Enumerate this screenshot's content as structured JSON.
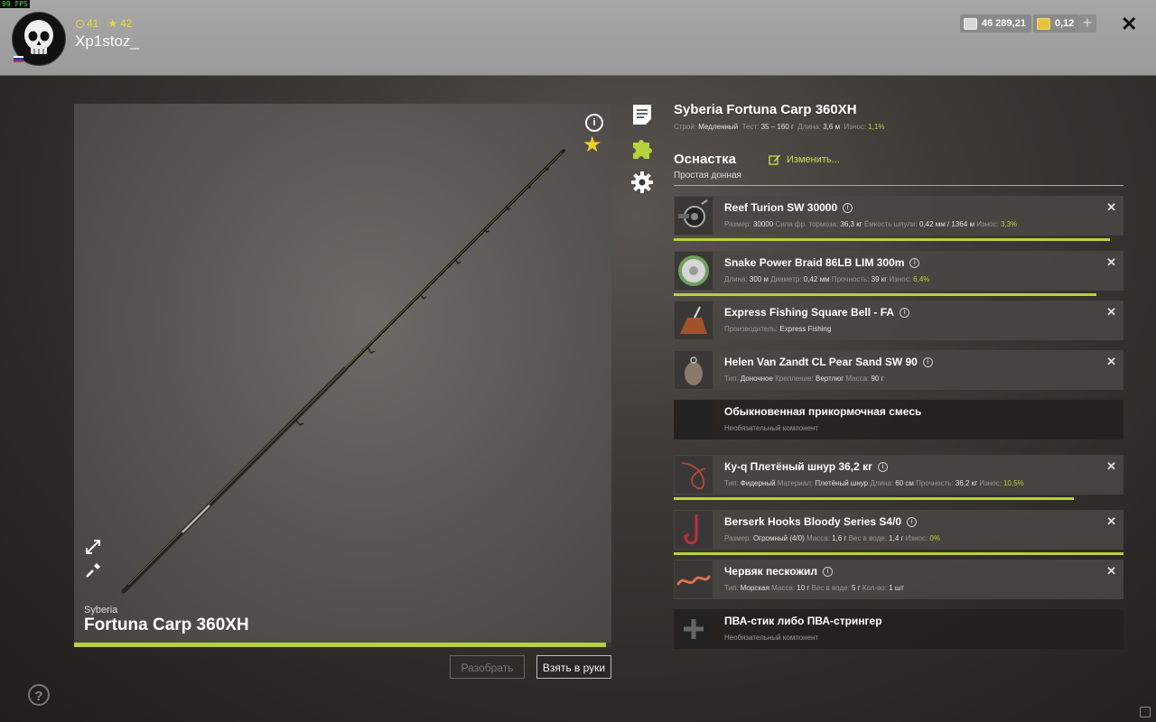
{
  "fps": "99 FPS",
  "player": {
    "name": "Xp1stoz_",
    "level_a": "41",
    "level_b": "42",
    "flag_colors": [
      "#ffffff",
      "#1f3fb8",
      "#d22f2f"
    ]
  },
  "currency": {
    "silver": "46 289,21",
    "gold": "0,12",
    "add": "+"
  },
  "close": "✕",
  "rod": {
    "brand": "Syberia",
    "model": "Fortuna Carp 360XH",
    "full_name": "Syberia Fortuna Carp 360XH",
    "specs": {
      "build_label": "Строй:",
      "build": "Медленный",
      "test_label": "Тест:",
      "test": "35 – 160 г",
      "length_label": "Длина:",
      "length": "3,6 м",
      "wear_label": "Износ:",
      "wear": "1,1%"
    },
    "wear_fraction": 0.99
  },
  "buttons": {
    "disassemble": "Разобрать",
    "take": "Взять в руки"
  },
  "rig": {
    "title": "Оснастка",
    "type": "Простая донная",
    "edit": "Изменить..."
  },
  "accent_color": "#b5d33a",
  "items": [
    {
      "name": "Reef Turion SW 30000",
      "desc": [
        [
          "Размер:",
          "30000"
        ],
        [
          "Сила фр. тормоза:",
          "36,3 кг"
        ],
        [
          "Ёмкость шпули:",
          "0,42 мм / 1364 м"
        ],
        [
          "Износ:",
          "3,3%"
        ]
      ],
      "bar": 0.97,
      "icon": "reel-icon"
    },
    {
      "name": "Snake Power Braid 86LB LIM 300m",
      "desc": [
        [
          "Длина:",
          "300 м"
        ],
        [
          "Диаметр:",
          "0,42 мм"
        ],
        [
          "Прочность:",
          "39 кг"
        ],
        [
          "Износ:",
          "6,4%"
        ]
      ],
      "bar": 0.94,
      "icon": "line-spool-icon"
    },
    {
      "name": "Express Fishing Square Bell - FA",
      "desc": [
        [
          "Производитель:",
          "Express Fishing"
        ]
      ],
      "bar": 0,
      "icon": "feeder-icon"
    },
    {
      "name": "Helen Van Zandt CL Pear Sand SW 90",
      "desc": [
        [
          "Тип:",
          "Доночное"
        ],
        [
          "Крепление:",
          "Вертлюг"
        ],
        [
          "Масса:",
          "90 г"
        ]
      ],
      "bar": 0,
      "icon": "sinker-icon"
    },
    {
      "name": "Обыкновенная прикормочная смесь",
      "desc_plain": "Необязательный компонент",
      "bar": 0,
      "icon": "empty-slot"
    },
    {
      "name": "Ку-q Плетёный шнур 36,2 кг",
      "desc": [
        [
          "Тип:",
          "Фидерный"
        ],
        [
          "Материал:",
          "Плетёный шнур"
        ],
        [
          "Длина:",
          "60 см"
        ],
        [
          "Прочность:",
          "36,2 кг"
        ],
        [
          "Износ:",
          "10,5%"
        ]
      ],
      "bar": 0.89,
      "icon": "leader-icon"
    },
    {
      "name": "Berserk Hooks Bloody Series S4/0",
      "desc": [
        [
          "Размер:",
          "Огромный (4/0)"
        ],
        [
          "Масса:",
          "1,6 г"
        ],
        [
          "Вес в воде:",
          "1,4 г"
        ],
        [
          "Износ:",
          "0%"
        ]
      ],
      "bar": 1.0,
      "icon": "hook-icon"
    },
    {
      "name": "Червяк пескожил",
      "desc": [
        [
          "Тип:",
          "Морская"
        ],
        [
          "Масса:",
          "10 г"
        ],
        [
          "Вес в воде:",
          "5 г"
        ],
        [
          "Кол-во:",
          "1 шт"
        ]
      ],
      "bar": 0,
      "icon": "worm-icon"
    },
    {
      "name": "ПВА-стик либо ПВА-стрингер",
      "desc_plain": "Необязательный компонент",
      "bar": 0,
      "icon": "add-slot-icon"
    }
  ]
}
